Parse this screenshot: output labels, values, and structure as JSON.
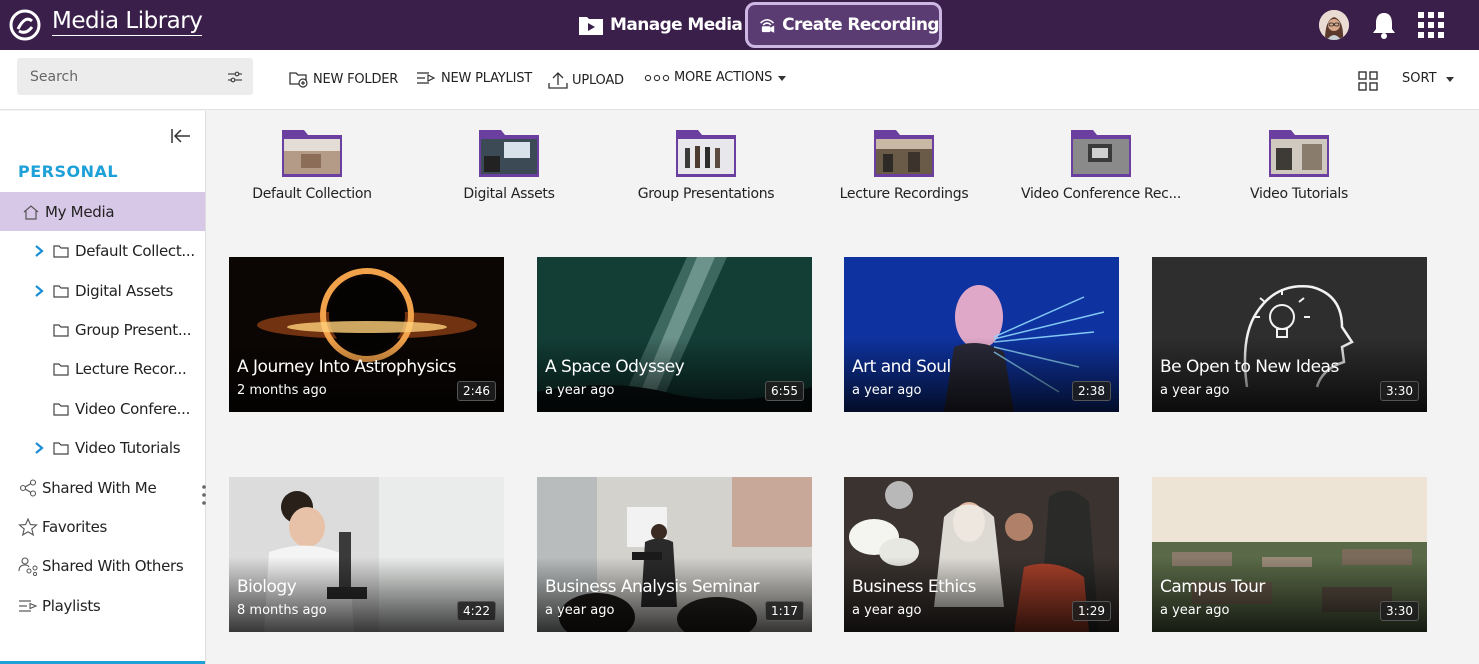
{
  "header": {
    "app_title": "Media Library",
    "manage_media": "Manage Media",
    "create_recording": "Create Recording"
  },
  "toolbar": {
    "search_placeholder": "Search",
    "new_folder": "NEW FOLDER",
    "new_playlist": "NEW PLAYLIST",
    "upload": "UPLOAD",
    "more_actions": "MORE ACTIONS",
    "sort": "SORT"
  },
  "sidebar": {
    "section": "PERSONAL",
    "items": [
      {
        "label": "My Media"
      },
      {
        "label": "Default Collect..."
      },
      {
        "label": "Digital Assets"
      },
      {
        "label": "Group Present..."
      },
      {
        "label": "Lecture Recor..."
      },
      {
        "label": "Video Confere..."
      },
      {
        "label": "Video Tutorials"
      },
      {
        "label": "Shared With Me"
      },
      {
        "label": "Favorites"
      },
      {
        "label": "Shared With Others"
      },
      {
        "label": "Playlists"
      }
    ]
  },
  "folders": [
    {
      "name": "Default Collection"
    },
    {
      "name": "Digital Assets"
    },
    {
      "name": "Group Presentations"
    },
    {
      "name": "Lecture Recordings"
    },
    {
      "name": "Video Conference Rec..."
    },
    {
      "name": "Video Tutorials"
    }
  ],
  "media": [
    {
      "title": "A Journey Into Astrophysics",
      "date": "2 months ago",
      "duration": "2:46"
    },
    {
      "title": "A Space Odyssey",
      "date": "a year ago",
      "duration": "6:55"
    },
    {
      "title": "Art and Soul",
      "date": "a year ago",
      "duration": "2:38"
    },
    {
      "title": "Be Open to New Ideas",
      "date": "a year ago",
      "duration": "3:30"
    },
    {
      "title": "Biology",
      "date": "8 months ago",
      "duration": "4:22"
    },
    {
      "title": "Business Analysis Seminar",
      "date": "a year ago",
      "duration": "1:17"
    },
    {
      "title": "Business Ethics",
      "date": "a year ago",
      "duration": "1:29"
    },
    {
      "title": "Campus Tour",
      "date": "a year ago",
      "duration": "3:30"
    }
  ],
  "colors": {
    "header_bg": "#3a1f4a",
    "accent_purple": "#6b3fa0",
    "active_bg": "#d8c8e8",
    "section_blue": "#1da1d8"
  }
}
